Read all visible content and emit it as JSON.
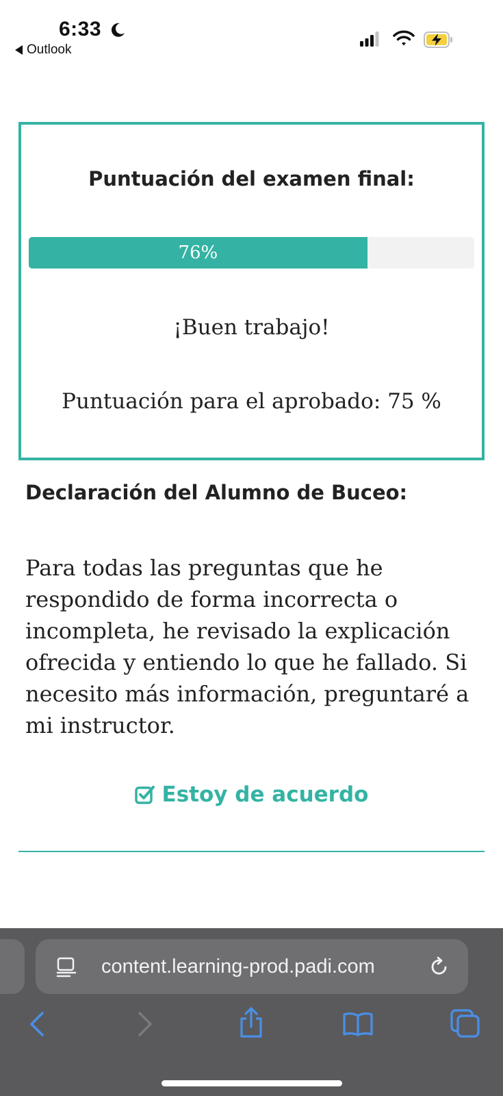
{
  "status_bar": {
    "time": "6:33",
    "back_app_label": "Outlook",
    "icons": [
      "moon-icon",
      "cellular-signal-icon",
      "wifi-icon",
      "battery-charging-icon"
    ]
  },
  "score_card": {
    "title": "Puntuación del examen final:",
    "progress_percent": 76,
    "progress_label": "76%",
    "message": "¡Buen trabajo!",
    "pass_score_text": "Puntuación para el aprobado: 75 %"
  },
  "declaration": {
    "title": "Declaración del Alumno de Buceo:",
    "body": "Para todas las preguntas que he respondido de forma incorrecta o incompleta, he revisado la explicación ofrecida y entiendo lo que he fallado. Si necesito más información, preguntaré a mi instructor.",
    "agree_label": "Estoy de acuerdo"
  },
  "browser": {
    "url": "content.learning-prod.padi.com",
    "toolbar_icons": [
      "back-arrow-icon",
      "forward-arrow-icon",
      "share-icon",
      "bookmarks-icon",
      "tabs-icon"
    ]
  },
  "colors": {
    "accent": "#34b3a4",
    "browser_bar": "#5a5a5c",
    "toolbar_icon": "#4a8fe8",
    "toolbar_icon_disabled": "#7a7a7e",
    "battery_charge": "#f4d03f"
  }
}
